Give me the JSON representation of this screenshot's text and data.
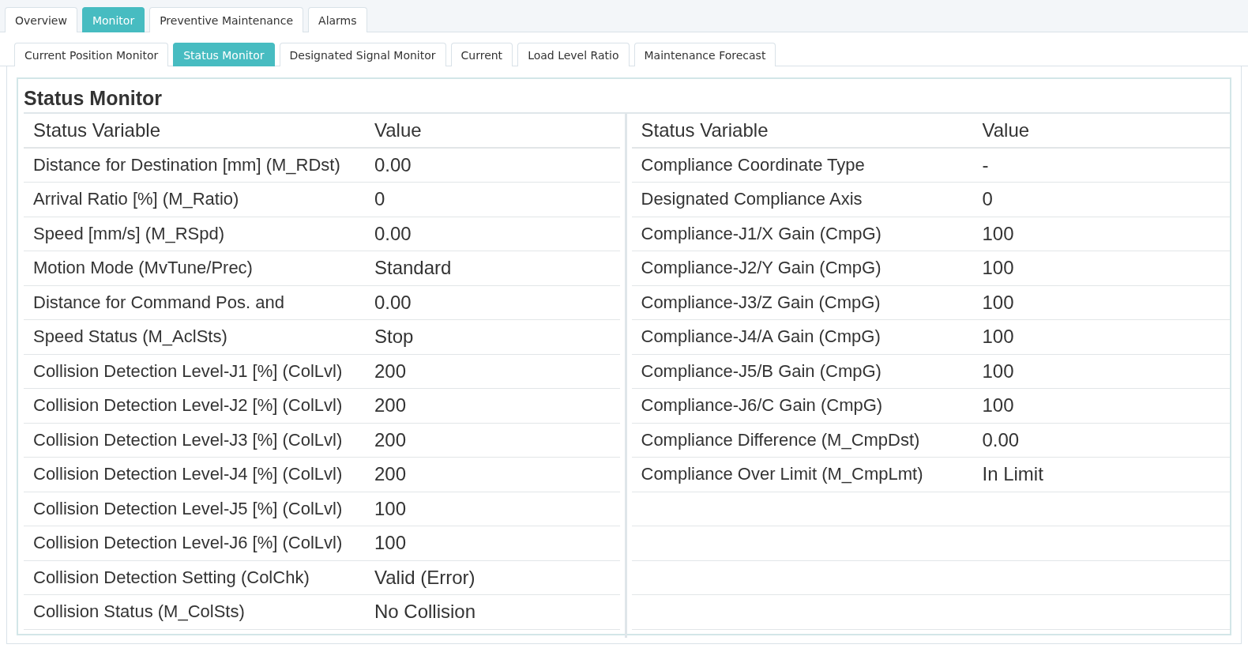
{
  "tabs": [
    {
      "label": "Overview",
      "selected": false
    },
    {
      "label": "Monitor",
      "selected": true
    },
    {
      "label": "Preventive Maintenance",
      "selected": false
    },
    {
      "label": "Alarms",
      "selected": false
    }
  ],
  "subtabs": [
    {
      "label": "Current Position Monitor",
      "selected": false
    },
    {
      "label": "Status Monitor",
      "selected": true
    },
    {
      "label": "Designated Signal Monitor",
      "selected": false
    },
    {
      "label": "Current",
      "selected": false
    },
    {
      "label": "Load Level Ratio",
      "selected": false
    },
    {
      "label": "Maintenance Forecast",
      "selected": false
    }
  ],
  "panel": {
    "title": "Status Monitor",
    "tables": [
      {
        "columns": [
          "Status Variable",
          "Value"
        ],
        "rows": [
          [
            "Distance for Destination [mm] (M_RDst)",
            "0.00"
          ],
          [
            "Arrival Ratio [%] (M_Ratio)",
            "0"
          ],
          [
            "Speed [mm/s] (M_RSpd)",
            "0.00"
          ],
          [
            "Motion Mode (MvTune/Prec)",
            "Standard"
          ],
          [
            "Distance for Command Pos. and",
            "0.00"
          ],
          [
            "Speed Status (M_AclSts)",
            "Stop"
          ],
          [
            "Collision Detection Level-J1 [%] (ColLvl)",
            "200"
          ],
          [
            "Collision Detection Level-J2 [%] (ColLvl)",
            "200"
          ],
          [
            "Collision Detection Level-J3 [%] (ColLvl)",
            "200"
          ],
          [
            "Collision Detection Level-J4 [%] (ColLvl)",
            "200"
          ],
          [
            "Collision Detection Level-J5 [%] (ColLvl)",
            "100"
          ],
          [
            "Collision Detection Level-J6 [%] (ColLvl)",
            "100"
          ],
          [
            "Collision Detection Setting (ColChk)",
            "Valid (Error)"
          ],
          [
            "Collision Status (M_ColSts)",
            "No Collision"
          ]
        ]
      },
      {
        "columns": [
          "Status Variable",
          "Value"
        ],
        "rows": [
          [
            "Compliance Coordinate Type",
            "-"
          ],
          [
            "Designated Compliance Axis",
            "0"
          ],
          [
            "Compliance-J1/X Gain (CmpG)",
            "100"
          ],
          [
            "Compliance-J2/Y Gain (CmpG)",
            "100"
          ],
          [
            "Compliance-J3/Z Gain (CmpG)",
            "100"
          ],
          [
            "Compliance-J4/A Gain (CmpG)",
            "100"
          ],
          [
            "Compliance-J5/B Gain (CmpG)",
            "100"
          ],
          [
            "Compliance-J6/C Gain (CmpG)",
            "100"
          ],
          [
            "Compliance Difference (M_CmpDst)",
            "0.00"
          ],
          [
            "Compliance Over Limit (M_CmpLmt)",
            "In Limit"
          ]
        ]
      }
    ]
  }
}
